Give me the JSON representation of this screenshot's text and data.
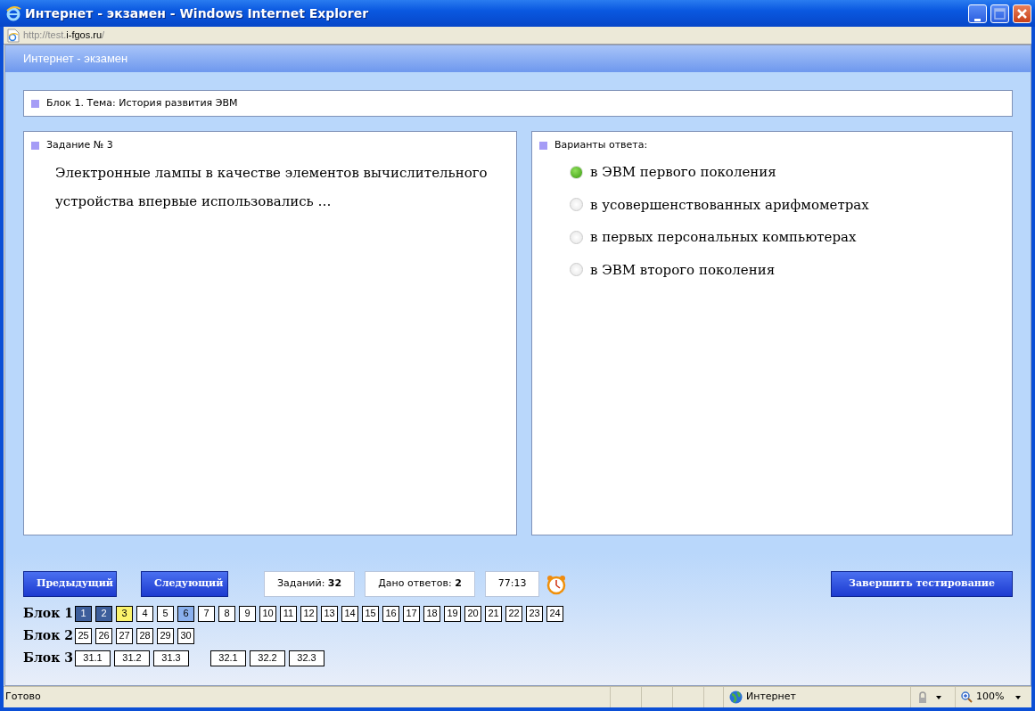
{
  "window": {
    "title": "Интернет - экзамен - Windows Internet Explorer"
  },
  "address": {
    "prefix": "http://test.",
    "domain": "i-fgos.ru",
    "suffix": "/"
  },
  "page_header": "Интернет - экзамен",
  "topic": "Блок 1. Тема: История развития ЭВМ",
  "task": {
    "heading": "Задание № 3",
    "text": "Электронные лампы в качестве элементов вычислительного устройства впервые использовались …"
  },
  "answers": {
    "heading": "Варианты ответа:",
    "options": [
      {
        "label": "в ЭВМ первого поколения",
        "selected": true
      },
      {
        "label": "в усовершенствованных арифмометрах",
        "selected": false
      },
      {
        "label": "в первых персональных компьютерах",
        "selected": false
      },
      {
        "label": "в ЭВМ второго поколения",
        "selected": false
      }
    ]
  },
  "nav_buttons": [
    "Предыдущий",
    "Следующий"
  ],
  "stats": [
    "Заданий: **32**",
    "Дано ответов: **2**"
  ],
  "timer": "77:13",
  "finish_button": "Завершить тестирование",
  "blocks": [
    {
      "label": "Блок 1",
      "groups": [
        [
          {
            "number": "1",
            "answered": true,
            "current": false,
            "flagged": false
          },
          {
            "number": "2",
            "answered": true,
            "current": false,
            "flagged": false
          },
          {
            "number": "3",
            "answered": false,
            "current": true,
            "flagged": false
          },
          {
            "number": "4",
            "answered": false,
            "current": false,
            "flagged": false
          },
          {
            "number": "5",
            "answered": false,
            "current": false,
            "flagged": false
          },
          {
            "number": "6",
            "answered": false,
            "current": false,
            "flagged": true
          },
          {
            "number": "7",
            "answered": false,
            "current": false,
            "flagged": false
          },
          {
            "number": "8",
            "answered": false,
            "current": false,
            "flagged": false
          },
          {
            "number": "9",
            "answered": false,
            "current": false,
            "flagged": false
          },
          {
            "number": "10",
            "answered": false,
            "current": false,
            "flagged": false
          },
          {
            "number": "11",
            "answered": false,
            "current": false,
            "flagged": false
          },
          {
            "number": "12",
            "answered": false,
            "current": false,
            "flagged": false
          },
          {
            "number": "13",
            "answered": false,
            "current": false,
            "flagged": false
          },
          {
            "number": "14",
            "answered": false,
            "current": false,
            "flagged": false
          },
          {
            "number": "15",
            "answered": false,
            "current": false,
            "flagged": false
          },
          {
            "number": "16",
            "answered": false,
            "current": false,
            "flagged": false
          },
          {
            "number": "17",
            "answered": false,
            "current": false,
            "flagged": false
          },
          {
            "number": "18",
            "answered": false,
            "current": false,
            "flagged": false
          },
          {
            "number": "19",
            "answered": false,
            "current": false,
            "flagged": false
          },
          {
            "number": "20",
            "answered": false,
            "current": false,
            "flagged": false
          },
          {
            "number": "21",
            "answered": false,
            "current": false,
            "flagged": false
          },
          {
            "number": "22",
            "answered": false,
            "current": false,
            "flagged": false
          },
          {
            "number": "23",
            "answered": false,
            "current": false,
            "flagged": false
          },
          {
            "number": "24",
            "answered": false,
            "current": false,
            "flagged": false
          }
        ]
      ]
    },
    {
      "label": "Блок 2",
      "groups": [
        [
          {
            "number": "25",
            "answered": false,
            "current": false,
            "flagged": false
          },
          {
            "number": "26",
            "answered": false,
            "current": false,
            "flagged": false
          },
          {
            "number": "27",
            "answered": false,
            "current": false,
            "flagged": false
          },
          {
            "number": "28",
            "answered": false,
            "current": false,
            "flagged": false
          },
          {
            "number": "29",
            "answered": false,
            "current": false,
            "flagged": false
          },
          {
            "number": "30",
            "answered": false,
            "current": false,
            "flagged": false
          }
        ]
      ]
    },
    {
      "label": "Блок 3",
      "groups": [
        [
          {
            "number": "31.1",
            "answered": false,
            "current": false,
            "flagged": false
          },
          {
            "number": "31.2",
            "answered": false,
            "current": false,
            "flagged": false
          },
          {
            "number": "31.3",
            "answered": false,
            "current": false,
            "flagged": false
          }
        ],
        [
          {
            "number": "32.1",
            "answered": false,
            "current": false,
            "flagged": false
          },
          {
            "number": "32.2",
            "answered": false,
            "current": false,
            "flagged": false
          },
          {
            "number": "32.3",
            "answered": false,
            "current": false,
            "flagged": false
          }
        ]
      ]
    }
  ],
  "status_bar": {
    "status": "Готово",
    "zone": "Интернет",
    "zoom": "100%"
  }
}
